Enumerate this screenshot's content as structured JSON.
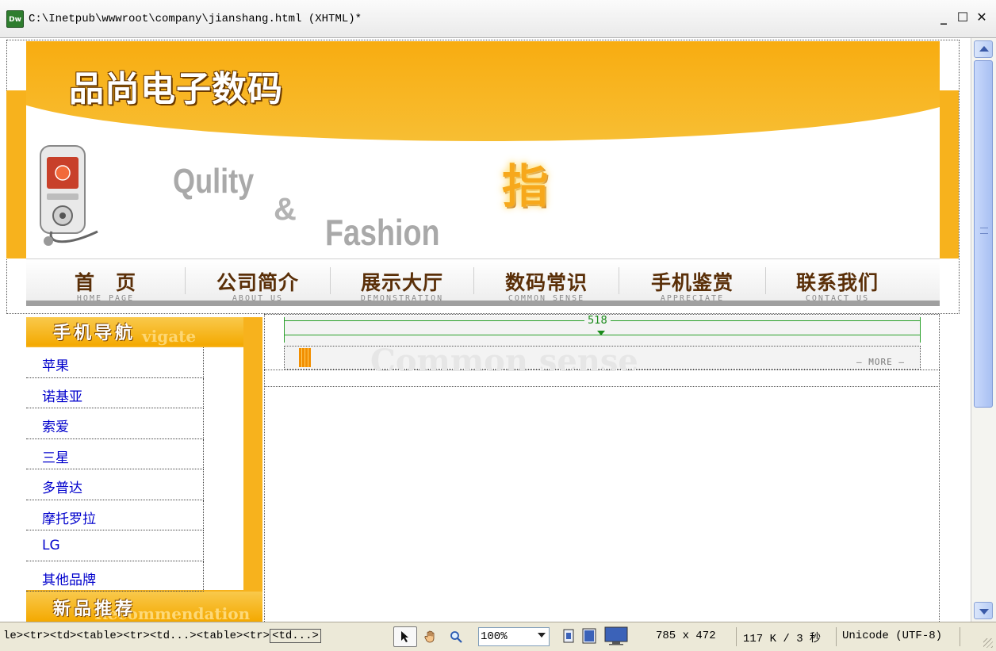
{
  "window": {
    "title": "C:\\Inetpub\\wwwroot\\company\\jianshang.html (XHTML)*",
    "app_icon": "Dw",
    "controls": [
      "_",
      "☐",
      "✕"
    ]
  },
  "banner": {
    "brand": "品尚电子数码",
    "word1": "Qulity",
    "word2": "&",
    "word3": "Fashion",
    "glyph": "指"
  },
  "nav": {
    "items": [
      {
        "zh": "首　页",
        "en": "HOME PAGE"
      },
      {
        "zh": "公司简介",
        "en": "ABOUT US"
      },
      {
        "zh": "展示大厅",
        "en": "DEMONSTRATION"
      },
      {
        "zh": "数码常识",
        "en": "COMMON SENSE"
      },
      {
        "zh": "手机鉴赏",
        "en": "APPRECIATE"
      },
      {
        "zh": "联系我们",
        "en": "CONTACT US"
      }
    ]
  },
  "sidebar": {
    "heading_zh": "手机导航",
    "heading_en": "vigate",
    "items": [
      "苹果",
      "诺基亚",
      "索爱",
      "三星",
      "多普达",
      "摩托罗拉",
      "LG",
      "其他品牌"
    ],
    "heading2_zh": "新品推荐",
    "heading2_en": "Recommendation"
  },
  "main": {
    "width_label": "518",
    "ghost_title": "Common sense",
    "more": "— MORE —"
  },
  "statusbar": {
    "tag_path": "le><tr><td><table><tr><td...><table><tr>",
    "tag_selected": "<td...>",
    "zoom": "100%",
    "dimensions": "785 x 472",
    "size_time": "117 K / 3 秒",
    "encoding": "Unicode (UTF-8)"
  }
}
